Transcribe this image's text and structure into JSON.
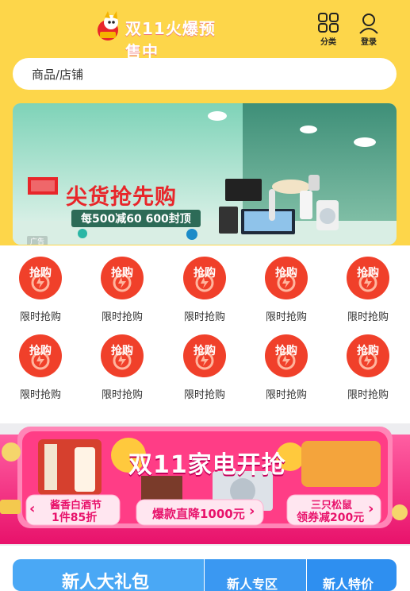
{
  "header": {
    "logo_text": "双11火爆预售中",
    "category_label": "分类",
    "login_label": "登录"
  },
  "search": {
    "placeholder": "商品/店铺"
  },
  "banner": {
    "title": "尖货抢先购",
    "subtitle": "每500减60 600封顶",
    "ad_tag": "广告"
  },
  "quick_links": {
    "badge_text": "抢购",
    "items": [
      "限时抢购",
      "限时抢购",
      "限时抢购",
      "限时抢购",
      "限时抢购",
      "限时抢购",
      "限时抢购",
      "限时抢购",
      "限时抢购",
      "限时抢购"
    ]
  },
  "promo": {
    "title": "双11家电开抢",
    "left_tag_line1": "酱香白酒节",
    "left_tag_line2": "1件85折",
    "center_tag": "爆款直降1000元",
    "right_tag_line1": "三只松鼠",
    "right_tag_line2": "领券减200元"
  },
  "bottom_tabs": {
    "tab1": "新人大礼包",
    "tab2": "新人专区",
    "tab3": "新人特价"
  },
  "colors": {
    "brand_yellow": "#FDD64A",
    "badge_red": "#F0402A",
    "promo_pink": "#F2207A",
    "tab_blue": "#2E8FF0"
  }
}
